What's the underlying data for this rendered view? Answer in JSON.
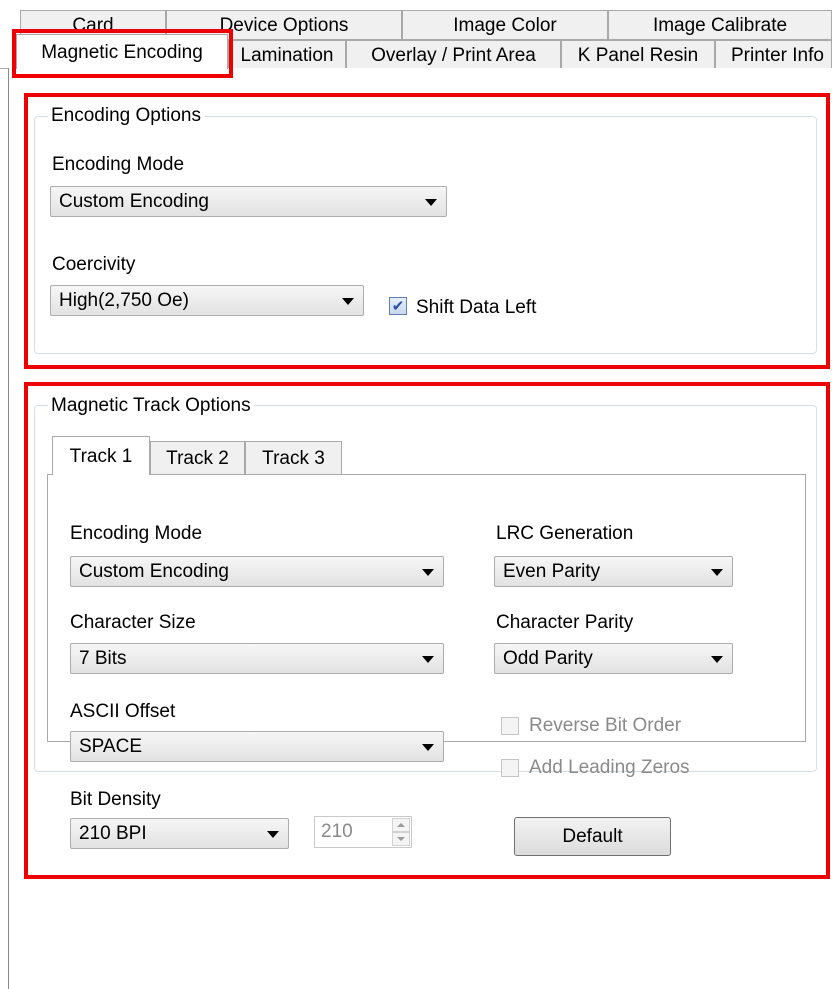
{
  "tabs_row1": [
    "Card",
    "Device Options",
    "Image Color",
    "Image Calibrate"
  ],
  "tabs_row2": [
    "Magnetic Encoding",
    "Lamination",
    "Overlay / Print Area",
    "K Panel Resin",
    "Printer Info"
  ],
  "encoding_options": {
    "title": "Encoding Options",
    "encoding_mode_label": "Encoding Mode",
    "encoding_mode_value": "Custom Encoding",
    "coercivity_label": "Coercivity",
    "coercivity_value": "High(2,750 Oe)",
    "shift_data_left_label": "Shift Data Left",
    "shift_data_left_checked": true
  },
  "track_options": {
    "title": "Magnetic Track Options",
    "tracks": [
      "Track 1",
      "Track 2",
      "Track 3"
    ],
    "encoding_mode_label": "Encoding Mode",
    "encoding_mode_value": "Custom Encoding",
    "lrc_generation_label": "LRC Generation",
    "lrc_generation_value": "Even Parity",
    "character_size_label": "Character Size",
    "character_size_value": "7 Bits",
    "character_parity_label": "Character Parity",
    "character_parity_value": "Odd Parity",
    "ascii_offset_label": "ASCII Offset",
    "ascii_offset_value": "SPACE",
    "reverse_bit_order_label": "Reverse Bit Order",
    "add_leading_zeros_label": "Add Leading Zeros",
    "bit_density_label": "Bit Density",
    "bit_density_value": "210 BPI",
    "bit_density_number": "210",
    "default_button": "Default"
  },
  "colors": {
    "highlight": "#ee0000",
    "check": "#2a4fa5"
  },
  "icons": {
    "dropdown": "chevron-down-icon",
    "check": "check-icon",
    "spin": "spin-arrows-icon"
  }
}
